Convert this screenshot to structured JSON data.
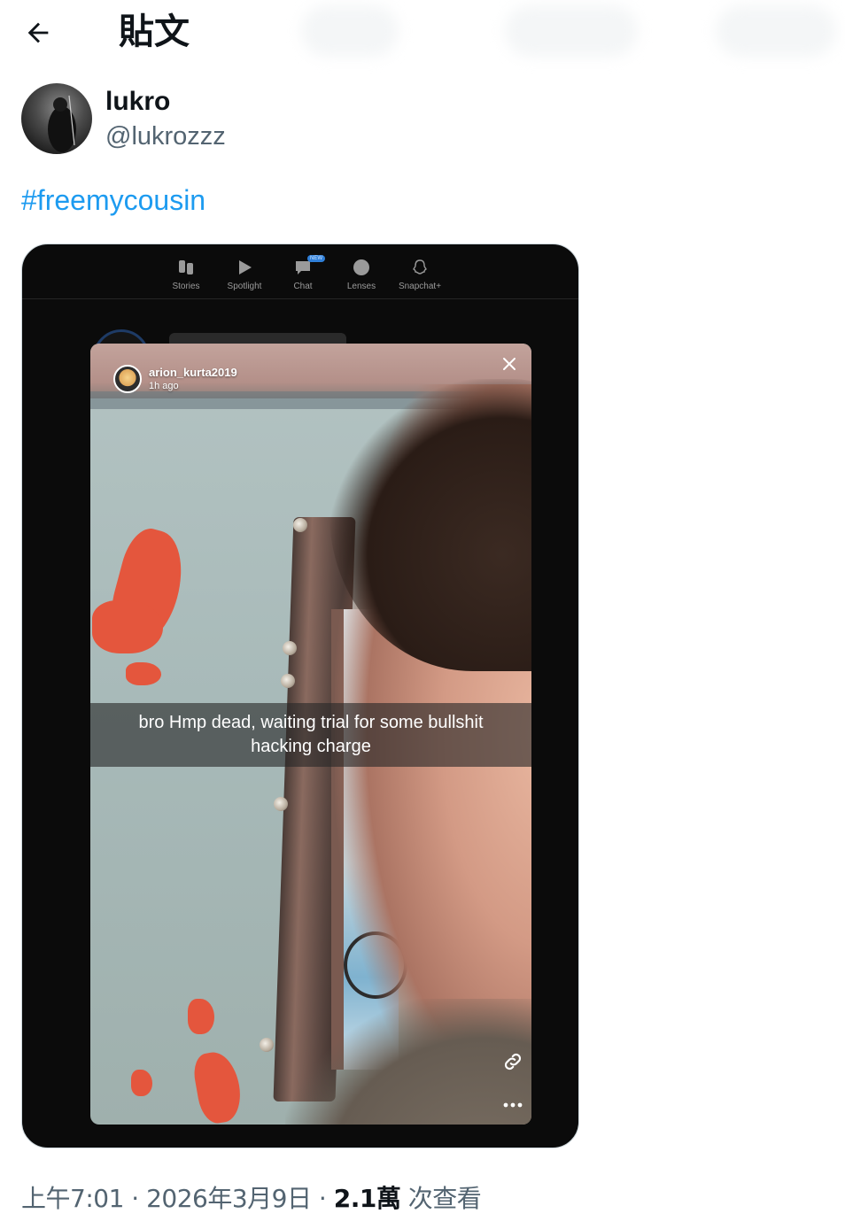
{
  "header": {
    "title": "貼文",
    "back_icon": "arrow-left-icon"
  },
  "author": {
    "name": "lukro",
    "handle": "@lukrozzz"
  },
  "tweet": {
    "text": "#freemycousin"
  },
  "media": {
    "snapchat_nav": [
      {
        "label": "Stories",
        "icon": "stories-icon"
      },
      {
        "label": "Spotlight",
        "icon": "play-icon"
      },
      {
        "label": "Chat",
        "icon": "chat-icon",
        "badge": "NEW"
      },
      {
        "label": "Lenses",
        "icon": "lens-icon"
      },
      {
        "label": "Snapchat+",
        "icon": "ghost-icon"
      }
    ],
    "story": {
      "username": "arion_kurta2019",
      "time": "1h ago",
      "caption": "bro Hmp dead, waiting trial for some bullshit hacking charge"
    }
  },
  "meta": {
    "time": "上午7:01",
    "separator": "·",
    "date": "2026年3月9日",
    "views_count": "2.1萬",
    "views_label": "次查看"
  },
  "colors": {
    "link": "#1d9bf0",
    "secondary_text": "#536471",
    "caption_bg": "#282828"
  }
}
